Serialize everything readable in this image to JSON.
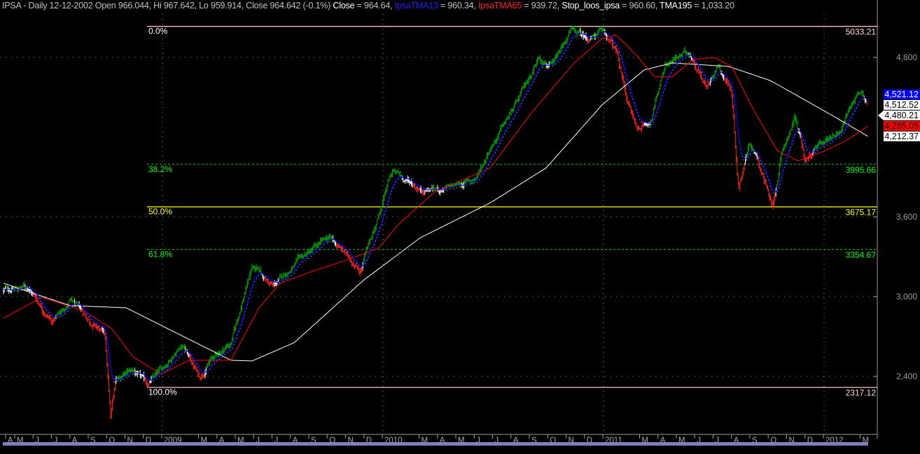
{
  "header": {
    "symbol_info": "IPSA - Daily 12-12-2002 Open 966.044, Hi 967.642, Lo 959.914, Close 964.642 (-0.1%)",
    "close_label": "Close",
    "close_value": " = 964.64, ",
    "tma13_label": "IpsaTMA13",
    "tma13_value": " = 960.34, ",
    "tma65_label": "IpsaTMA65",
    "tma65_value": " = 939.72, ",
    "stop_label": "Stop_loos_ipsa",
    "stop_value": " = 960.60, ",
    "tma195_label": "TMA195",
    "tma195_value": " = 1,033.20"
  },
  "colors": {
    "background": "#000000",
    "tma13": "#0000ff",
    "tma65": "#ff0000",
    "tma195": "#ffffff",
    "up": "#00a000",
    "down": "#ff2020",
    "neutral": "#ffffff",
    "warn": "#ffff00",
    "scrollbar": "#7f7fbf"
  },
  "chart_data": {
    "type": "candlestick-bar",
    "title": "IPSA - Daily",
    "x_unit": "months since start (Apr 2008)",
    "ylim": [
      2000,
      5150
    ],
    "y_ticks": [
      "2,400",
      "3,000",
      "3,600",
      "4,800"
    ],
    "y_tick_values": [
      2400,
      3000,
      3600,
      4800
    ],
    "price_waypoints": [
      [
        0,
        3047
      ],
      [
        1.3,
        3074
      ],
      [
        2.6,
        2810
      ],
      [
        3.53,
        2968
      ],
      [
        4.65,
        2810
      ],
      [
        5.39,
        2705
      ],
      [
        5.69,
        2074
      ],
      [
        5.95,
        2390
      ],
      [
        6.88,
        2442
      ],
      [
        7.62,
        2337
      ],
      [
        8.36,
        2442
      ],
      [
        9.48,
        2653
      ],
      [
        10.41,
        2390
      ],
      [
        10.97,
        2521
      ],
      [
        12.08,
        2653
      ],
      [
        13.2,
        3232
      ],
      [
        14.31,
        3074
      ],
      [
        15.8,
        3284
      ],
      [
        17.29,
        3442
      ],
      [
        18.03,
        3337
      ],
      [
        18.96,
        3205
      ],
      [
        19.89,
        3600
      ],
      [
        20.63,
        3942
      ],
      [
        22.12,
        3811
      ],
      [
        23.61,
        3811
      ],
      [
        25.09,
        3889
      ],
      [
        25.84,
        4126
      ],
      [
        27.32,
        4468
      ],
      [
        28.44,
        4810
      ],
      [
        29.18,
        4731
      ],
      [
        30.11,
        4995
      ],
      [
        31.04,
        4942
      ],
      [
        31.86,
        4995
      ],
      [
        32.53,
        4837
      ],
      [
        33.09,
        4495
      ],
      [
        33.64,
        4258
      ],
      [
        34.39,
        4337
      ],
      [
        35.13,
        4758
      ],
      [
        36.43,
        4837
      ],
      [
        37.36,
        4574
      ],
      [
        37.92,
        4758
      ],
      [
        38.66,
        4547
      ],
      [
        39.03,
        3811
      ],
      [
        39.59,
        4179
      ],
      [
        40.33,
        3916
      ],
      [
        40.82,
        3653
      ],
      [
        41.26,
        4021
      ],
      [
        42.01,
        4363
      ],
      [
        42.57,
        4021
      ],
      [
        43.68,
        4179
      ],
      [
        44.42,
        4258
      ],
      [
        45.17,
        4495
      ],
      [
        45.54,
        4558
      ],
      [
        45.84,
        4484
      ]
    ],
    "tma195": [
      [
        0,
        3100
      ],
      [
        3.53,
        2932
      ],
      [
        6.51,
        2916
      ],
      [
        9.48,
        2705
      ],
      [
        12.08,
        2521
      ],
      [
        13.2,
        2516
      ],
      [
        15.43,
        2653
      ],
      [
        19.14,
        3126
      ],
      [
        22.12,
        3442
      ],
      [
        25.84,
        3705
      ],
      [
        28.81,
        3968
      ],
      [
        31.78,
        4442
      ],
      [
        34.01,
        4705
      ],
      [
        35.5,
        4758
      ],
      [
        38.48,
        4732
      ],
      [
        40.71,
        4626
      ],
      [
        43.68,
        4389
      ],
      [
        45.91,
        4205
      ]
    ],
    "tma65": [
      [
        0,
        2837
      ],
      [
        2.04,
        2995
      ],
      [
        4.28,
        2890
      ],
      [
        5.76,
        2758
      ],
      [
        6.88,
        2547
      ],
      [
        8.36,
        2416
      ],
      [
        9.85,
        2521
      ],
      [
        12.08,
        2521
      ],
      [
        13.57,
        2916
      ],
      [
        14.68,
        3100
      ],
      [
        16.17,
        3179
      ],
      [
        18.4,
        3284
      ],
      [
        19.89,
        3363
      ],
      [
        21,
        3547
      ],
      [
        22.86,
        3784
      ],
      [
        25.84,
        3968
      ],
      [
        28.07,
        4389
      ],
      [
        30.3,
        4758
      ],
      [
        31.78,
        4942
      ],
      [
        32.53,
        4968
      ],
      [
        33.64,
        4811
      ],
      [
        34.57,
        4653
      ],
      [
        35.5,
        4653
      ],
      [
        36.62,
        4784
      ],
      [
        37.73,
        4800
      ],
      [
        38.66,
        4732
      ],
      [
        39.78,
        4416
      ],
      [
        41.08,
        4100
      ],
      [
        42.19,
        4021
      ],
      [
        43.68,
        4100
      ],
      [
        44.8,
        4179
      ],
      [
        45.91,
        4284
      ]
    ],
    "fibonacci": {
      "start_t": 7.62,
      "levels": [
        {
          "pct": "0.0%",
          "value": "5033.21",
          "price": 5033.21,
          "color": "#ffc0c0",
          "style": "solid",
          "label_color": "#ffffff"
        },
        {
          "pct": "38.2%",
          "value": "3995.66",
          "price": 3995.66,
          "color": "#00d000",
          "style": "dashed",
          "label_color": "#00ff00"
        },
        {
          "pct": "50.0%",
          "value": "3675.17",
          "price": 3675.17,
          "color": "#ffff00",
          "style": "solid",
          "label_color": "#ffff00"
        },
        {
          "pct": "61.8%",
          "value": "3354.67",
          "price": 3354.67,
          "color": "#00d000",
          "style": "dashed",
          "label_color": "#00ff00"
        },
        {
          "pct": "100.0%",
          "value": "2317.12",
          "price": 2317.12,
          "color": "#ffc0c0",
          "style": "solid",
          "label_color": "#ffffff"
        }
      ]
    },
    "last_value_labels": [
      {
        "text": "4,521.12",
        "price": 4521.12,
        "bg": "#0000ff",
        "fg": "#ffffff"
      },
      {
        "text": "4,512.52",
        "price": 4500,
        "bg": "#ffffff",
        "fg": "#000000"
      },
      {
        "text": "4,480.21",
        "price": 4480.21,
        "bg": "#ffffff",
        "fg": "#000000",
        "arrow": true
      },
      {
        "text": "4,285.05",
        "price": 4285.05,
        "bg": "#ff0000",
        "fg": "#000000"
      },
      {
        "text": "4,212.37",
        "price": 4212.37,
        "bg": "#ffffff",
        "fg": "#000000"
      }
    ],
    "month_labels": [
      {
        "m": -0.5,
        "l": "A"
      },
      {
        "m": 0,
        "l": "M"
      },
      {
        "m": 1,
        "l": "J"
      },
      {
        "m": 2,
        "l": "J"
      },
      {
        "m": 3,
        "l": "A"
      },
      {
        "m": 4,
        "l": "S"
      },
      {
        "m": 5,
        "l": "O"
      },
      {
        "m": 6,
        "l": "N"
      },
      {
        "m": 7,
        "l": "D"
      },
      {
        "m": 8,
        "l": "2009"
      },
      {
        "m": 10,
        "l": "M"
      },
      {
        "m": 11,
        "l": "A"
      },
      {
        "m": 12,
        "l": "M"
      },
      {
        "m": 13,
        "l": "J"
      },
      {
        "m": 14,
        "l": "J"
      },
      {
        "m": 15,
        "l": "A"
      },
      {
        "m": 16,
        "l": "S"
      },
      {
        "m": 17,
        "l": "O"
      },
      {
        "m": 18,
        "l": "N"
      },
      {
        "m": 19,
        "l": "D"
      },
      {
        "m": 20,
        "l": "2010"
      },
      {
        "m": 22,
        "l": "M"
      },
      {
        "m": 23,
        "l": "A"
      },
      {
        "m": 24,
        "l": "M"
      },
      {
        "m": 25,
        "l": "J"
      },
      {
        "m": 26,
        "l": "J"
      },
      {
        "m": 27,
        "l": "A"
      },
      {
        "m": 28,
        "l": "S"
      },
      {
        "m": 29,
        "l": "O"
      },
      {
        "m": 30,
        "l": "N"
      },
      {
        "m": 31,
        "l": "D"
      },
      {
        "m": 32,
        "l": "2011"
      },
      {
        "m": 34,
        "l": "M"
      },
      {
        "m": 35,
        "l": "A"
      },
      {
        "m": 36,
        "l": "M"
      },
      {
        "m": 37,
        "l": "J"
      },
      {
        "m": 38,
        "l": "J"
      },
      {
        "m": 39,
        "l": "A"
      },
      {
        "m": 40,
        "l": "S"
      },
      {
        "m": 41,
        "l": "O"
      },
      {
        "m": 42,
        "l": "N"
      },
      {
        "m": 43,
        "l": "D"
      },
      {
        "m": 44,
        "l": "2012"
      },
      {
        "m": 46,
        "l": "M"
      }
    ]
  }
}
